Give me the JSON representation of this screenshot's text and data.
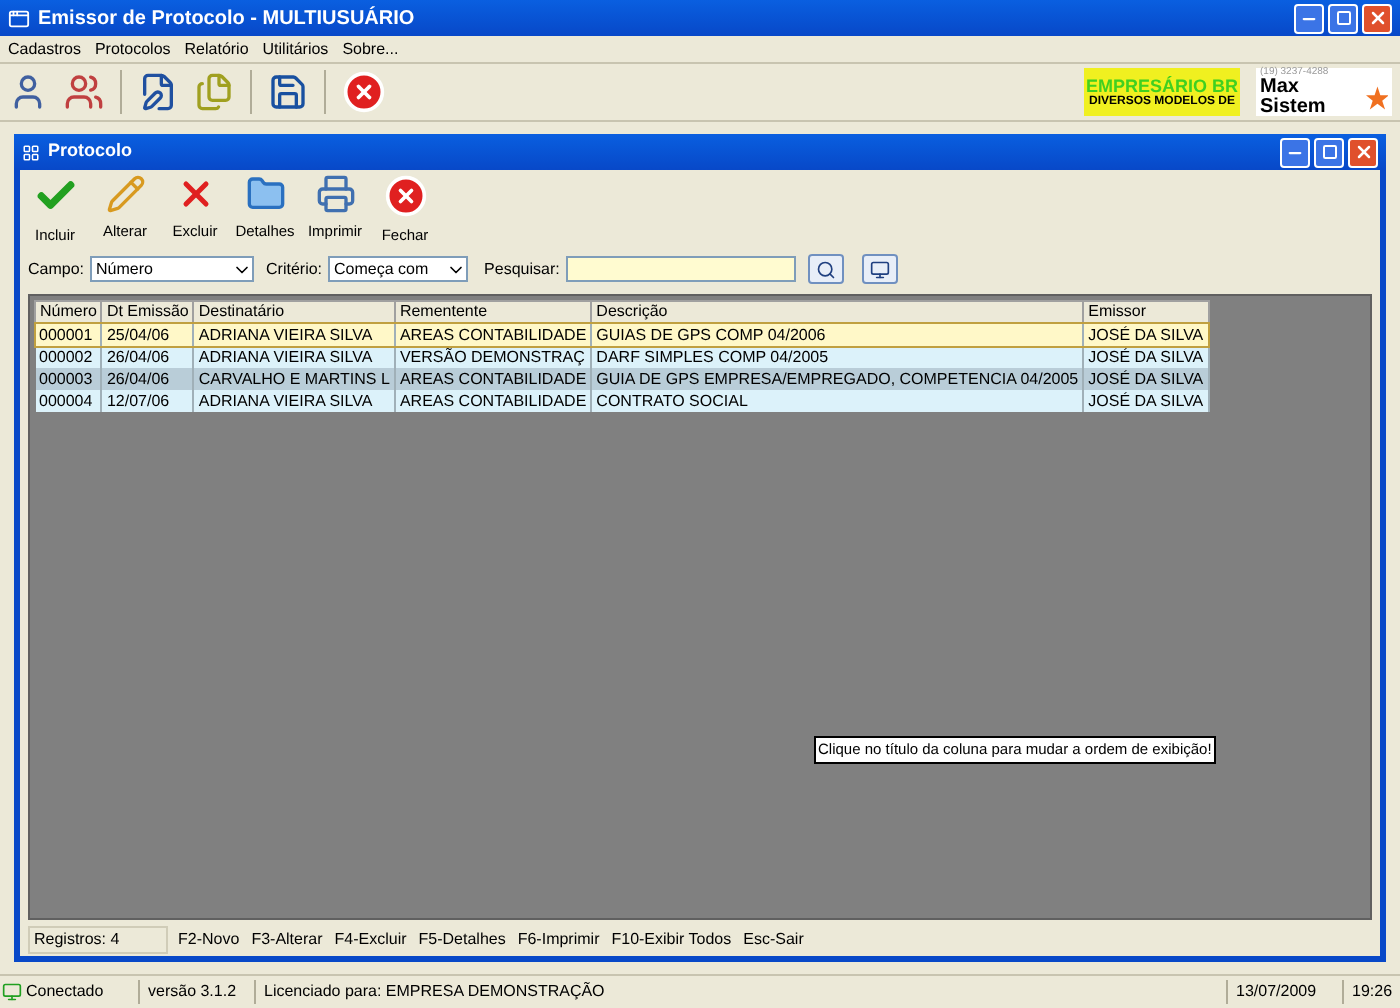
{
  "app_window": {
    "title": "Emissor de Protocolo - MULTIUSUÁRIO"
  },
  "menu": [
    "Cadastros",
    "Protocolos",
    "Relatório",
    "Utilitários",
    "Sobre..."
  ],
  "ads": [
    {
      "kind": "empresario",
      "line_1": "EMPRESÁRIO BR",
      "line_2": "DIVERSOS MODELOS DE"
    },
    {
      "kind": "maxsistem",
      "line_1": "(19) 3237-4288",
      "line_2": "Max Sistem"
    }
  ],
  "child_window": {
    "title": "Protocolo"
  },
  "toolbar": [
    {
      "kind": "check",
      "label": "Incluir"
    },
    {
      "kind": "pencil",
      "label": "Alterar"
    },
    {
      "kind": "delete",
      "label": "Excluir"
    },
    {
      "kind": "folder",
      "label": "Detalhes"
    },
    {
      "kind": "printer",
      "label": "Imprimir"
    },
    {
      "kind": "close",
      "label": "Fechar"
    }
  ],
  "filter": {
    "field_label": "Campo:",
    "field_value": "Número",
    "criteria_label": "Critério:",
    "criteria_value": "Começa com",
    "search_label": "Pesquisar:"
  },
  "table": {
    "columns": [
      "Número",
      "Dt Emissão",
      "Destinatário",
      "Rementente",
      "Descrição",
      "Emissor"
    ],
    "rows": [
      {
        "selected": true,
        "color": "#fff8c8",
        "cells": [
          "000001",
          "25/04/06",
          "ADRIANA VIEIRA SILVA",
          "AREAS CONTABILIDADE",
          "GUIAS DE GPS COMP 04/2006",
          "JOSÉ DA SILVA"
        ]
      },
      {
        "selected": false,
        "color": "#dcf2fa",
        "cells": [
          "000002",
          "26/04/06",
          "ADRIANA VIEIRA SILVA",
          "VERSÃO DEMONSTRAÇ",
          "DARF SIMPLES COMP 04/2005",
          "JOSÉ DA SILVA"
        ]
      },
      {
        "selected": false,
        "color": "#b9cdd8",
        "cells": [
          "000003",
          "26/04/06",
          "CARVALHO E MARTINS L",
          "AREAS CONTABILIDADE",
          "GUIA DE GPS EMPRESA/EMPREGADO, COMPETENCIA 04/2005",
          "JOSÉ DA SILVA"
        ]
      },
      {
        "selected": false,
        "color": "#dcf2fa",
        "cells": [
          "000004",
          "12/07/06",
          "ADRIANA VIEIRA SILVA",
          "AREAS CONTABILIDADE",
          "CONTRATO SOCIAL",
          "JOSÉ DA SILVA"
        ]
      }
    ]
  },
  "hint": "Clique no título da coluna para mudar a ordem de exibição!",
  "window_status": [
    "Registros: 4",
    "F2-Novo",
    "F3-Alterar",
    "F4-Excluir",
    "F5-Detalhes",
    "F6-Imprimir",
    "F10-Exibir Todos",
    "Esc-Sair"
  ],
  "status_bar": {
    "connection": "Conectado",
    "version": "versão 3.1.2",
    "license": "Licenciado para: EMPRESA DEMONSTRAÇÃO",
    "date": "13/07/2009",
    "time": "19:26"
  }
}
